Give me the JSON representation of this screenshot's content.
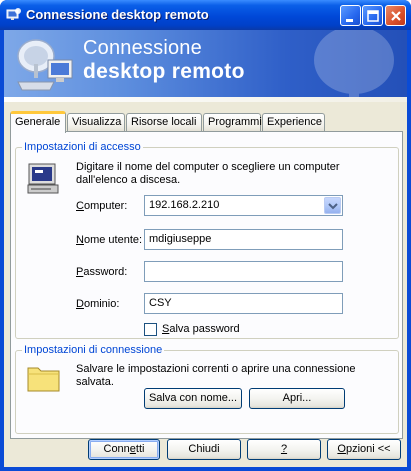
{
  "window": {
    "title": "Connessione desktop remoto",
    "icon": "remote-desktop-icon",
    "controls": [
      "minimize-icon",
      "maximize-icon",
      "close-icon"
    ]
  },
  "banner": {
    "line1": "Connessione",
    "line2": "desktop remoto"
  },
  "tabs": [
    {
      "label": "Generale",
      "active": true
    },
    {
      "label": "Visualizza",
      "active": false
    },
    {
      "label": "Risorse locali",
      "active": false
    },
    {
      "label": "Programmi",
      "active": false
    },
    {
      "label": "Experience",
      "active": false
    }
  ],
  "login": {
    "legend": "Impostazioni di accesso",
    "icon": "computer-icon",
    "description": "Digitare il nome del computer o scegliere un computer dall'elenco a discesa.",
    "computer": {
      "label": "Computer:",
      "value": "192.168.2.210"
    },
    "username": {
      "label": "Nome utente:",
      "value": "mdigiuseppe"
    },
    "password": {
      "label": "Password:",
      "value": ""
    },
    "domain": {
      "label": "Dominio:",
      "value": "CSY"
    },
    "save_password": {
      "label": "Salva password",
      "checked": false
    }
  },
  "connection": {
    "legend": "Impostazioni di connessione",
    "icon": "folder-icon",
    "description": "Salvare le impostazioni correnti o aprire una connessione salvata.",
    "save_as": "Salva con nome...",
    "open": "Apri..."
  },
  "footer": {
    "connect": "Connetti",
    "cancel": "Chiudi",
    "help": "?",
    "options": "Opzioni <<"
  }
}
